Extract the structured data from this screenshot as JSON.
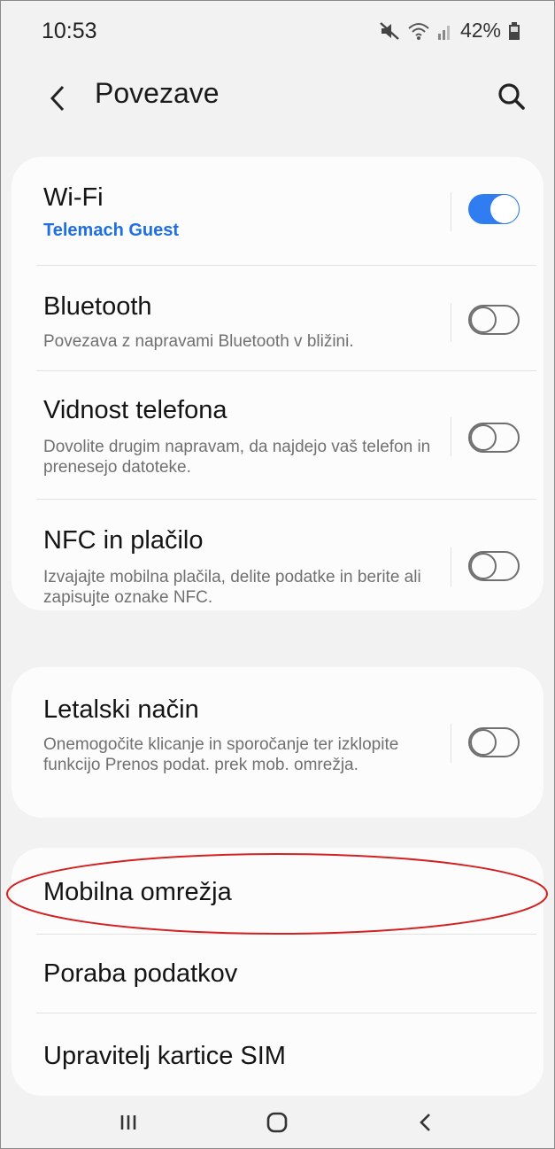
{
  "status_bar": {
    "time": "10:53",
    "battery": "42%",
    "icons": [
      "mute-icon",
      "wifi-icon",
      "signal-icon",
      "battery-icon"
    ]
  },
  "header": {
    "title": "Povezave",
    "back_icon": "chevron-left-icon",
    "search_icon": "search-icon"
  },
  "settings": {
    "wifi": {
      "title": "Wi-Fi",
      "subtitle": "Telemach Guest",
      "enabled": true
    },
    "bluetooth": {
      "title": "Bluetooth",
      "subtitle": "Povezava z napravami Bluetooth v bližini.",
      "enabled": false
    },
    "visibility": {
      "title": "Vidnost telefona",
      "subtitle": "Dovolite drugim napravam, da najdejo vaš telefon in prenesejo datoteke.",
      "enabled": false
    },
    "nfc": {
      "title": "NFC in plačilo",
      "subtitle": "Izvajajte mobilna plačila, delite podatke in berite ali zapisujte oznake NFC.",
      "enabled": false
    },
    "airplane": {
      "title": "Letalski način",
      "subtitle": "Onemogočite klicanje in sporočanje ter izklopite funkcijo Prenos podat. prek mob. omrežja.",
      "enabled": false
    },
    "mobile_networks": {
      "title": "Mobilna omrežja"
    },
    "data_usage": {
      "title": "Poraba podatkov"
    },
    "sim_manager": {
      "title": "Upravitelj kartice SIM"
    }
  },
  "colors": {
    "accent": "#2f7df0",
    "wifi_subtitle": "#1d6fe3",
    "annotation": "#d42020"
  },
  "navbar": {
    "icons": [
      "recent-apps-icon",
      "home-icon",
      "back-icon"
    ]
  }
}
